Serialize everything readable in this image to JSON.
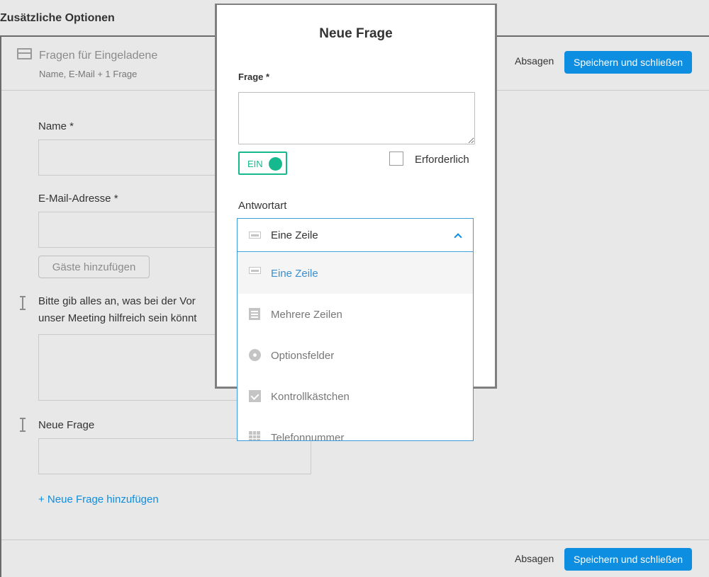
{
  "page": {
    "heading": "Zusätzliche Optionen"
  },
  "section": {
    "title": "Fragen für Eingeladene",
    "subtitle": "Name, E-Mail + 1 Frage",
    "cancel_label": "Absagen",
    "save_label": "Speichern und schließen"
  },
  "form": {
    "name_label": "Name *",
    "email_label": "E-Mail-Adresse *",
    "add_guests_label": "Gäste hinzufügen",
    "question_line1": "Bitte gib alles an, was bei der Vor",
    "question_line2": "unser Meeting hilfreich sein könnt",
    "new_question_label": "Neue Frage",
    "add_question_link": "+ Neue Frage hinzufügen"
  },
  "footer": {
    "cancel_label": "Absagen",
    "save_label": "Speichern und schließen"
  },
  "modal": {
    "title": "Neue Frage",
    "question_label": "Frage *",
    "toggle_label": "EIN",
    "toggle_on": true,
    "required_label": "Erforderlich",
    "required_checked": false,
    "answer_type_label": "Antwortart",
    "selected_answer_type": "Eine Zeile",
    "options": [
      {
        "label": "Eine Zeile",
        "icon": "single-line-icon"
      },
      {
        "label": "Mehrere Zeilen",
        "icon": "multi-line-icon"
      },
      {
        "label": "Optionsfelder",
        "icon": "radio-icon"
      },
      {
        "label": "Kontrollkästchen",
        "icon": "checkbox-icon"
      },
      {
        "label": "Telefonnummer",
        "icon": "phone-grid-icon"
      }
    ]
  },
  "colors": {
    "accent": "#0e8ee0",
    "toggle_green": "#16b98e",
    "background": "#e8e8e8"
  }
}
